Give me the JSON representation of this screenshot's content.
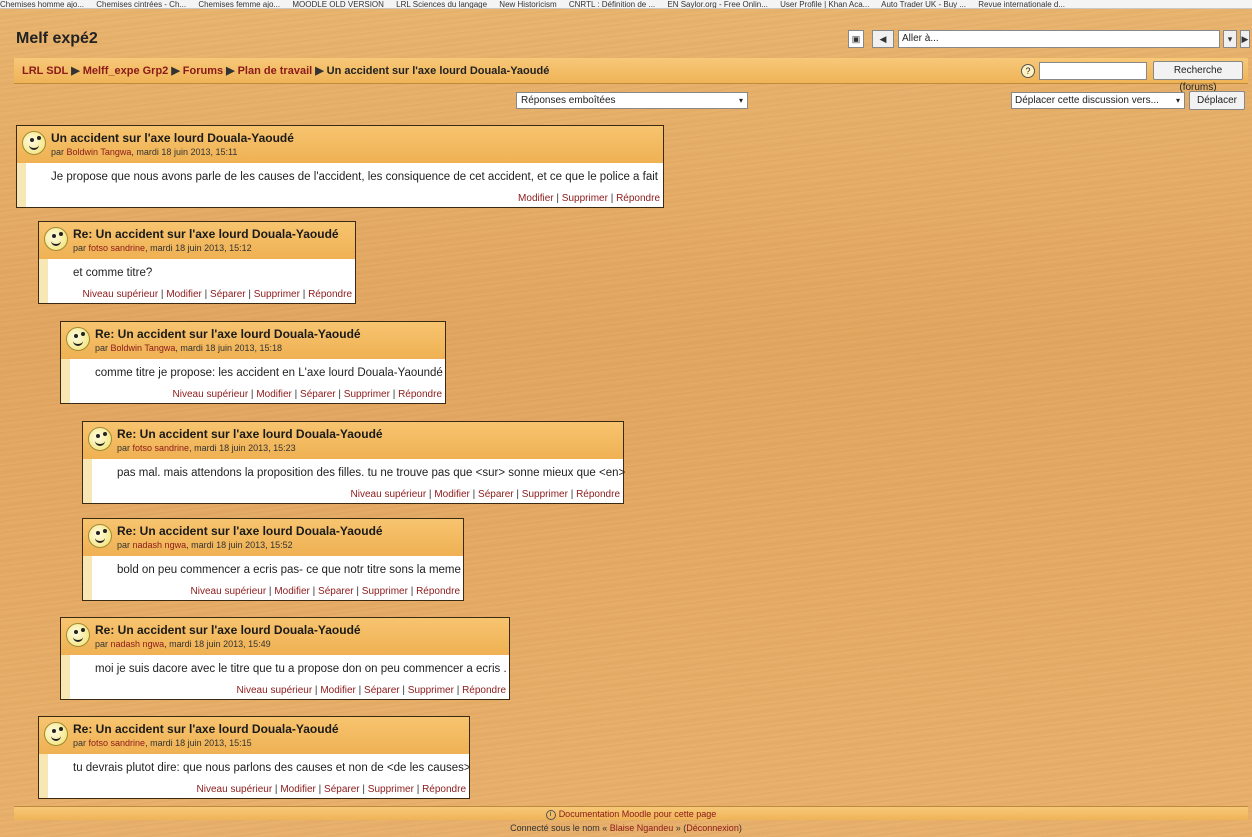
{
  "bookmarks": [
    "Chemises homme ajo...",
    "Chemises cintrées - Ch...",
    "Chemises femme ajo...",
    "MOODLE OLD VERSION",
    "LRL Sciences du langage",
    "New Historicism",
    "CNRTL : Définition de ...",
    "EN Saylor.org - Free Onlin...",
    "User Profile | Khan Aca...",
    "Auto Trader UK - Buy ...",
    "Revue internationale d..."
  ],
  "site_title": "Melf expé2",
  "jump": {
    "prev": "◀",
    "next": "▶",
    "select_label": "Aller à...",
    "caret": "▾"
  },
  "breadcrumb": [
    "LRL SDL",
    "Melff_expe Grp2",
    "Forums",
    "Plan de travail",
    "Un accident sur l'axe lourd Douala-Yaoudé"
  ],
  "breadcrumb_sep": "▶",
  "search": {
    "help": "?",
    "value": "",
    "button": "Recherche (forums)"
  },
  "display_mode": "Réponses emboîtées",
  "move": {
    "select": "Déplacer cette discussion vers...",
    "button": "Déplacer"
  },
  "posts": [
    {
      "subject": "Un accident sur l'axe lourd Douala-Yaoudé",
      "by": "par",
      "author": "Boldwin Tangwa",
      "date": ", mardi 18 juin 2013, 15:11",
      "content": "Je propose que nous avons parle de les causes de l'accident, les consiquence de cet accident, et ce que le police a fait",
      "commands": [
        "Modifier",
        "Supprimer",
        "Répondre"
      ]
    },
    {
      "subject": "Re: Un accident sur l'axe lourd Douala-Yaoudé",
      "by": "par",
      "author": "fotso sandrine",
      "date": ", mardi 18 juin 2013, 15:12",
      "content": "et comme titre?",
      "commands": [
        "Niveau supérieur",
        "Modifier",
        "Séparer",
        "Supprimer",
        "Répondre"
      ]
    },
    {
      "subject": "Re: Un accident sur l'axe lourd Douala-Yaoudé",
      "by": "par",
      "author": "Boldwin Tangwa",
      "date": ", mardi 18 juin 2013, 15:18",
      "content": "comme titre je propose: les accident en L'axe lourd Douala-Yaoundé",
      "commands": [
        "Niveau supérieur",
        "Modifier",
        "Séparer",
        "Supprimer",
        "Répondre"
      ]
    },
    {
      "subject": "Re: Un accident sur l'axe lourd Douala-Yaoudé",
      "by": "par",
      "author": "fotso sandrine",
      "date": ", mardi 18 juin 2013, 15:23",
      "content": "pas mal. mais attendons la proposition des filles. tu ne trouve pas que <sur> sonne mieux que <en>",
      "commands": [
        "Niveau supérieur",
        "Modifier",
        "Séparer",
        "Supprimer",
        "Répondre"
      ]
    },
    {
      "subject": "Re: Un accident sur l'axe lourd Douala-Yaoudé",
      "by": "par",
      "author": "nadash ngwa",
      "date": ", mardi 18 juin 2013, 15:52",
      "content": "bold on peu commencer a ecris pas- ce que notr titre sons la meme",
      "commands": [
        "Niveau supérieur",
        "Modifier",
        "Séparer",
        "Supprimer",
        "Répondre"
      ]
    },
    {
      "subject": "Re: Un accident sur l'axe lourd Douala-Yaoudé",
      "by": "par",
      "author": "nadash ngwa",
      "date": ", mardi 18 juin 2013, 15:49",
      "content": "moi je suis dacore avec le titre que tu a propose don on peu commencer a ecris .",
      "commands": [
        "Niveau supérieur",
        "Modifier",
        "Séparer",
        "Supprimer",
        "Répondre"
      ]
    },
    {
      "subject": "Re: Un accident sur l'axe lourd Douala-Yaoudé",
      "by": "par",
      "author": "fotso sandrine",
      "date": ", mardi 18 juin 2013, 15:15",
      "content": "tu devrais plutot dire: que nous parlons des causes et non de <de les causes>",
      "commands": [
        "Niveau supérieur",
        "Modifier",
        "Séparer",
        "Supprimer",
        "Répondre"
      ]
    }
  ],
  "footer": {
    "doc_icon": "i",
    "doc_link": "Documentation Moodle pour cette page",
    "login_prefix": "Connecté sous le nom « ",
    "login_user": "Blaise Ngandeu",
    "login_mid": " » (",
    "logout": "Déconnexion",
    "login_suffix": ")"
  }
}
